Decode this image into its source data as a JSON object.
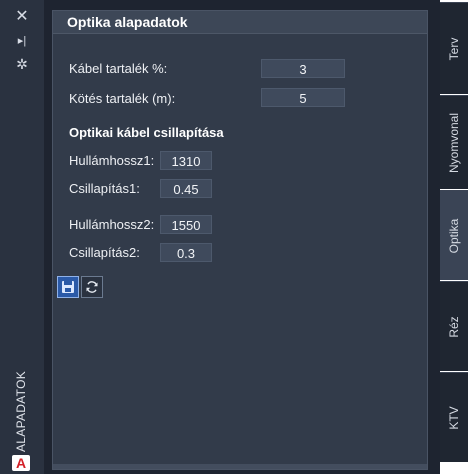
{
  "sidebar": {
    "close_icon": "close-icon",
    "pin_icon": "pin-icon",
    "settings_icon": "gear-icon",
    "title": "ALAPADATOK",
    "logo_letter": "A"
  },
  "panel": {
    "title": "Optika alapadatok",
    "fields": {
      "kabel_label": "Kábel tartalék %:",
      "kabel_value": "3",
      "kotes_label": "Kötés tartalék (m):",
      "kotes_value": "5"
    },
    "section_title": "Optikai kábel csillapítása",
    "wave": {
      "h1_label": "Hullámhossz1:",
      "h1_value": "1310",
      "c1_label": "Csillapítás1:",
      "c1_value": "0.45",
      "h2_label": "Hullámhossz2:",
      "h2_value": "1550",
      "c2_label": "Csillapítás2:",
      "c2_value": "0.3"
    },
    "buttons": {
      "save_icon": "save-icon",
      "refresh_icon": "refresh-icon"
    }
  },
  "tabs": [
    {
      "label": "Terv",
      "active": false
    },
    {
      "label": "Nyomvonal",
      "active": false
    },
    {
      "label": "Optika",
      "active": true
    },
    {
      "label": "Réz",
      "active": false
    },
    {
      "label": "KTV",
      "active": false
    }
  ],
  "colors": {
    "save_button": "#2b5aa8",
    "logo_red": "#d42027"
  }
}
